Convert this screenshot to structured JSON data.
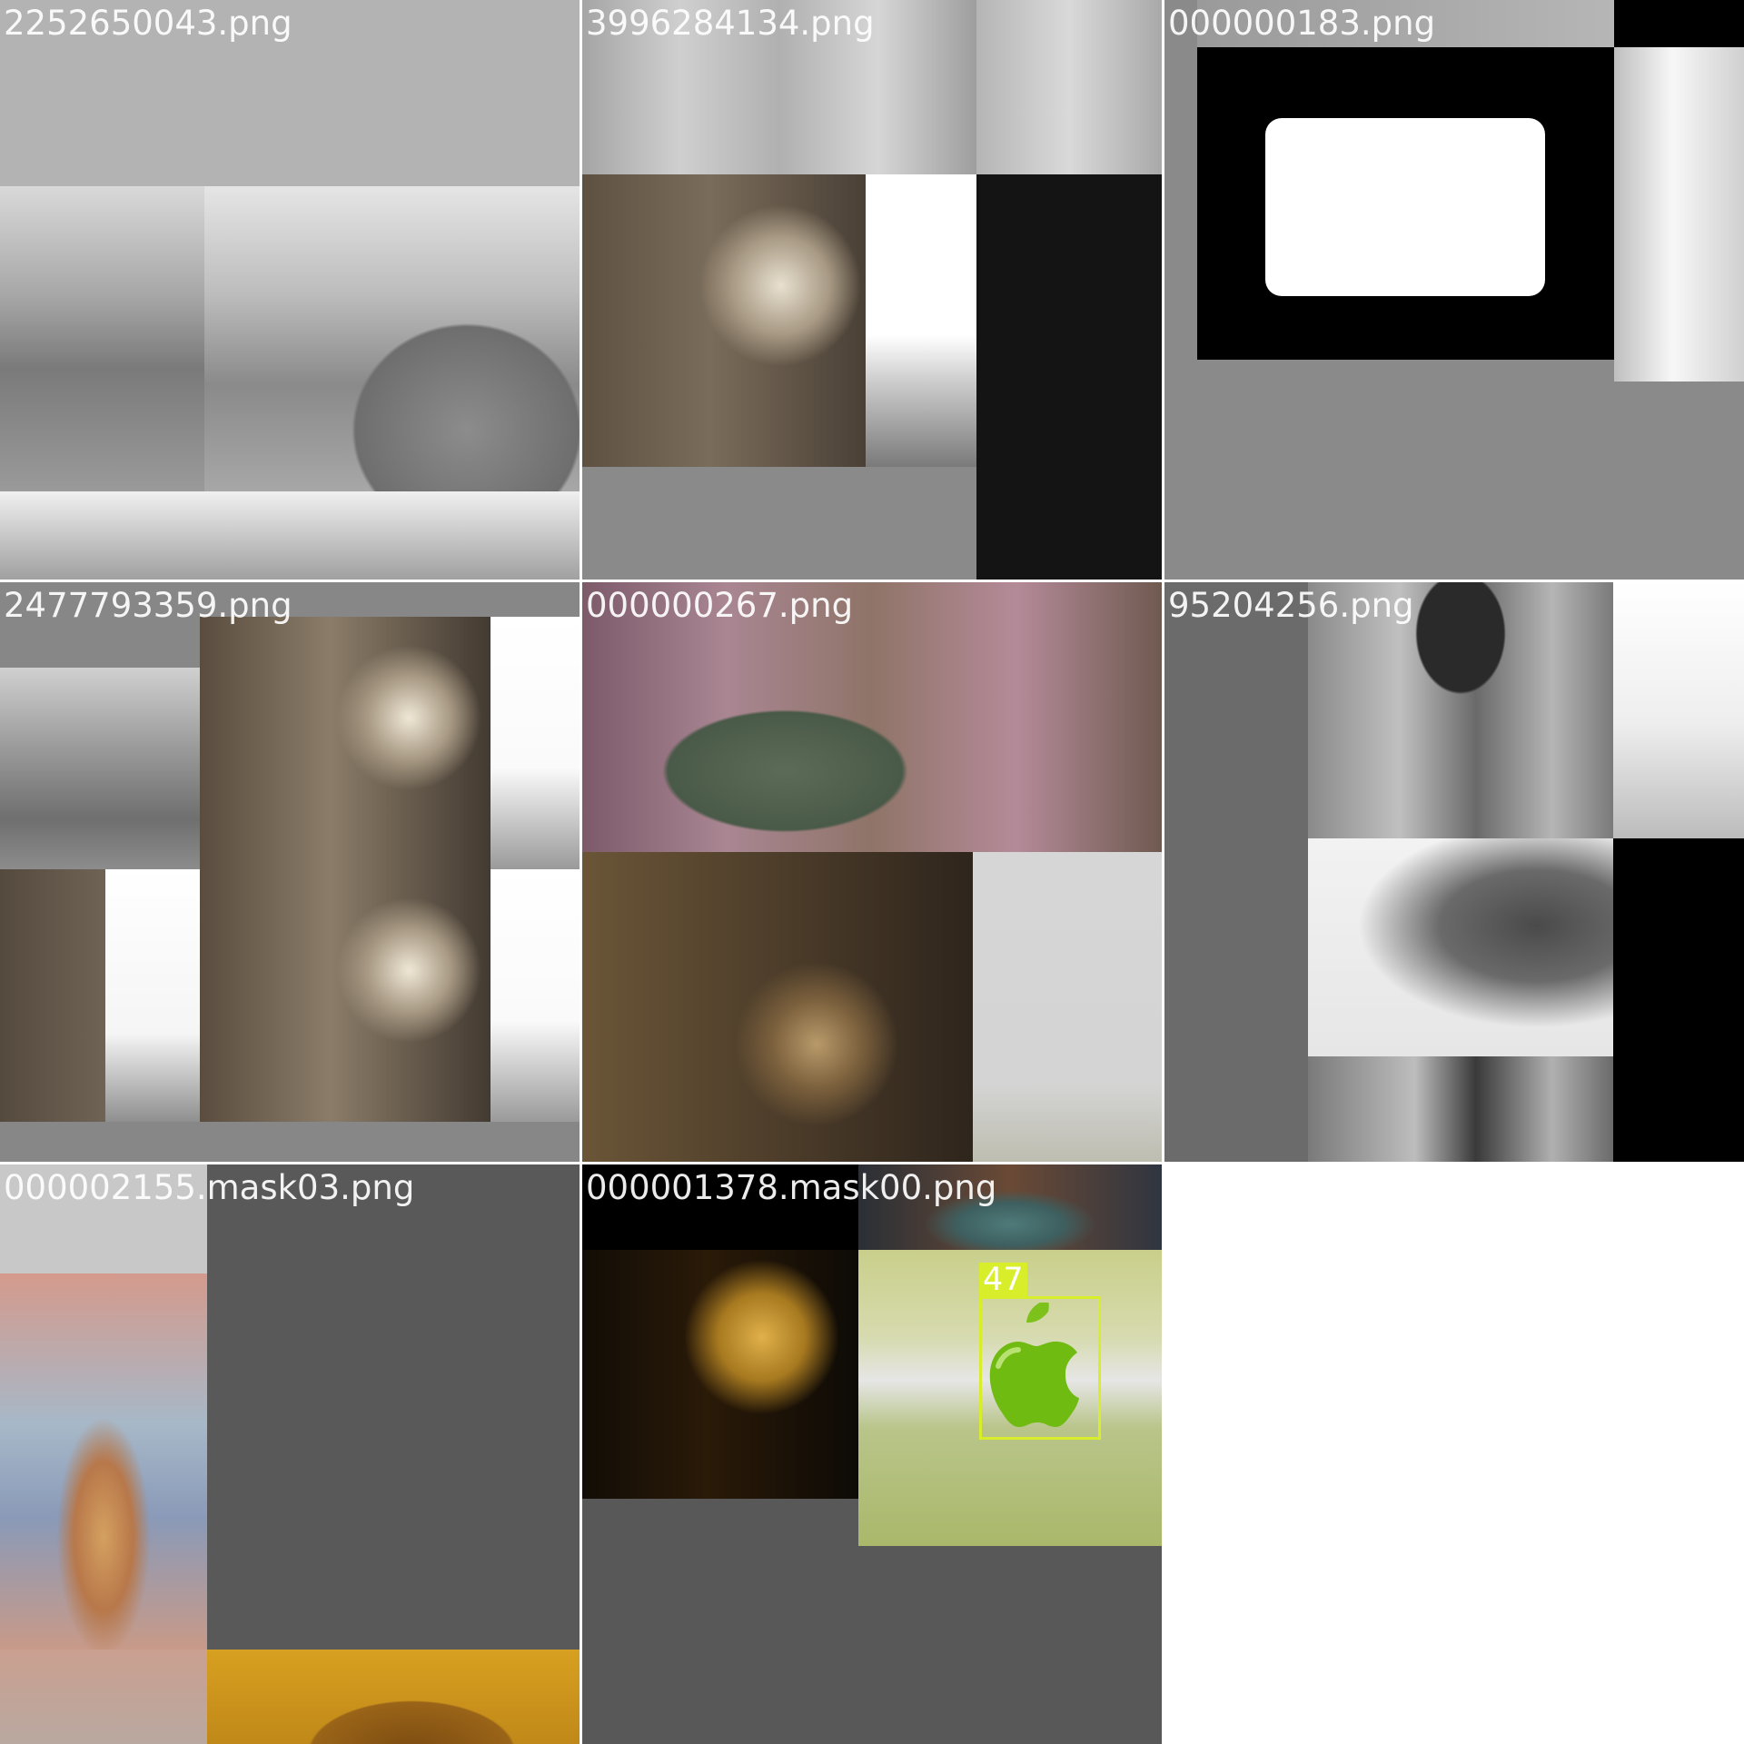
{
  "tiles": [
    {
      "filename": "2252650043.png",
      "background": "#b3b3b3"
    },
    {
      "filename": "3996284134.png",
      "background": "#8a8a8a"
    },
    {
      "filename": "000000183.png",
      "background": "#8a8a8a"
    },
    {
      "filename": "2477793359.png",
      "background": "#878787"
    },
    {
      "filename": "000000267.png",
      "background": "#3a3128"
    },
    {
      "filename": "95204256.png",
      "background": "#6b6b6b"
    },
    {
      "filename": "000002155.mask03.png",
      "background": "#595959"
    },
    {
      "filename": "000001378.mask00.png",
      "background": "#585858"
    }
  ],
  "detection": {
    "label": "47",
    "color": "#d8ee2a"
  },
  "icons": {
    "apple": "apple-icon"
  }
}
